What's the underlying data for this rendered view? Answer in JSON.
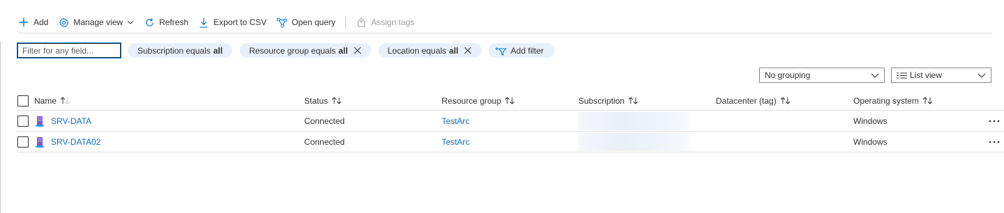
{
  "toolbar": {
    "add": "Add",
    "manage_view": "Manage view",
    "refresh": "Refresh",
    "export_csv": "Export to CSV",
    "open_query": "Open query",
    "assign_tags": "Assign tags"
  },
  "filters": {
    "placeholder": "Filter for any field...",
    "pills": [
      {
        "text": "Subscription equals",
        "value": "all"
      },
      {
        "text": "Resource group equals",
        "value": "all"
      },
      {
        "text": "Location equals",
        "value": "all"
      }
    ],
    "add_filter": "Add filter"
  },
  "grouping": {
    "value": "No grouping"
  },
  "view": {
    "value": "List view"
  },
  "table": {
    "columns": [
      "Name",
      "Status",
      "Resource group",
      "Subscription",
      "Datacenter (tag)",
      "Operating system"
    ],
    "rows": [
      {
        "name": "SRV-DATA",
        "status": "Connected",
        "resource_group": "TestArc",
        "subscription": "",
        "datacenter": "",
        "os": "Windows"
      },
      {
        "name": "SRV-DATA02",
        "status": "Connected",
        "resource_group": "TestArc",
        "subscription": "",
        "datacenter": "",
        "os": "Windows"
      }
    ]
  },
  "colors": {
    "accent": "#0078d4",
    "link": "#0f6cbd",
    "pill_bg": "#e8f1fb",
    "text": "#323130",
    "disabled": "#a19f9d"
  }
}
